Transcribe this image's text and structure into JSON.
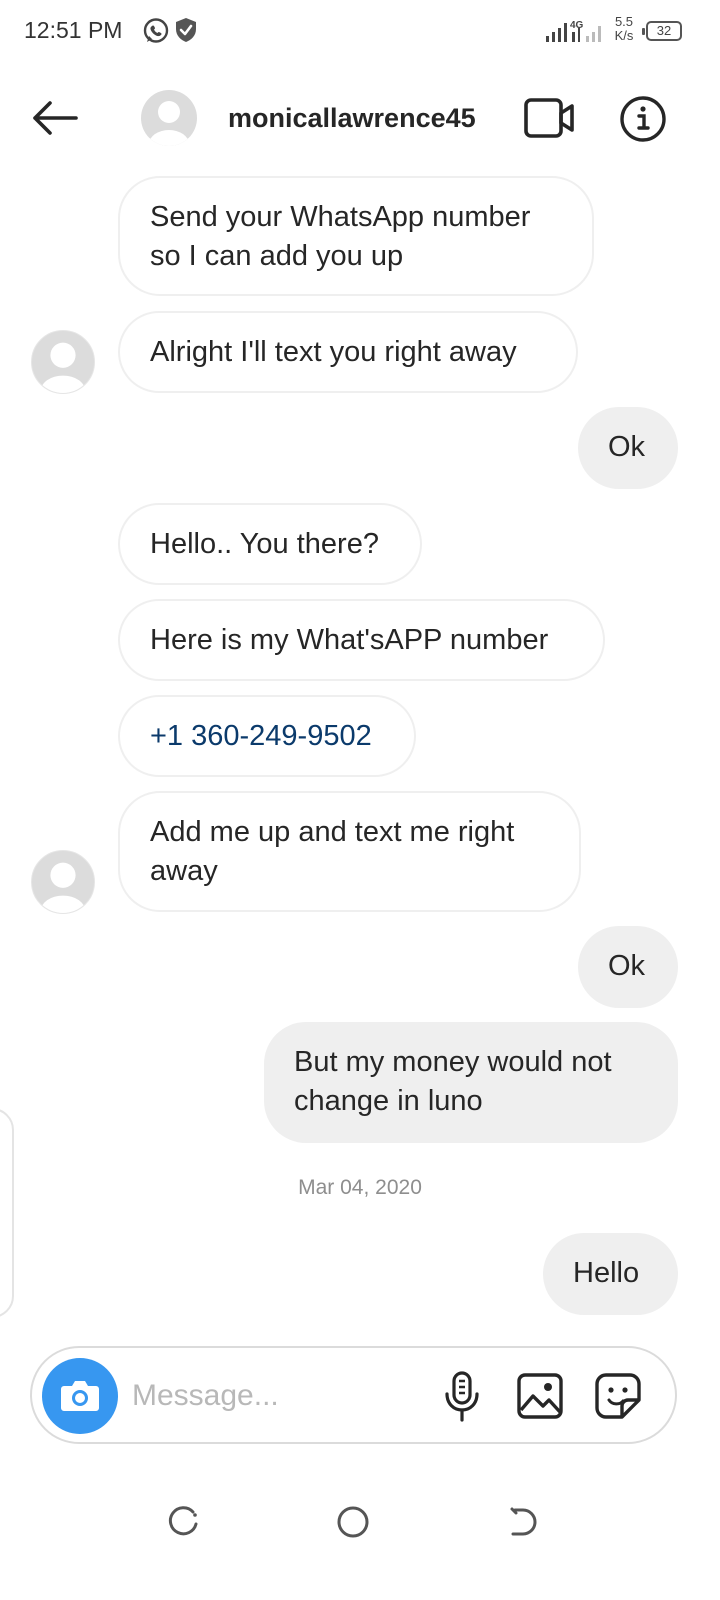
{
  "status_bar": {
    "time": "12:51 PM",
    "network_type": "4G",
    "speed_value": "5.5",
    "speed_unit": "K/s",
    "battery": "32",
    "icons": [
      "whatsapp-icon",
      "shield-icon",
      "signal-icon",
      "battery-icon"
    ]
  },
  "header": {
    "username": "monicallawrence45",
    "icons": [
      "back-arrow-icon",
      "video-call-icon",
      "info-icon"
    ]
  },
  "messages": [
    {
      "direction": "incoming",
      "text": "Send your WhatsApp number so I can add you up"
    },
    {
      "direction": "incoming",
      "text": "Alright I'll text you right away"
    },
    {
      "direction": "outgoing",
      "text": "Ok"
    },
    {
      "direction": "incoming",
      "text": "Hello.. You there?"
    },
    {
      "direction": "incoming",
      "text": "Here is my What'sAPP number"
    },
    {
      "direction": "incoming",
      "text": "+1 360-249-9502",
      "is_link": true
    },
    {
      "direction": "incoming",
      "text": "Add me up and text me right away"
    },
    {
      "direction": "outgoing",
      "text": "Ok"
    },
    {
      "direction": "outgoing",
      "text": "But my money would not change in luno"
    },
    {
      "direction": "outgoing",
      "text": "Hello"
    }
  ],
  "date_separator": "Mar 04, 2020",
  "composer": {
    "placeholder": "Message...",
    "icons": [
      "camera-icon",
      "microphone-icon",
      "gallery-icon",
      "sticker-icon"
    ]
  },
  "colors": {
    "camera_button": "#3797f0",
    "outgoing_bubble": "#efefef",
    "link": "#0b3a6b"
  }
}
